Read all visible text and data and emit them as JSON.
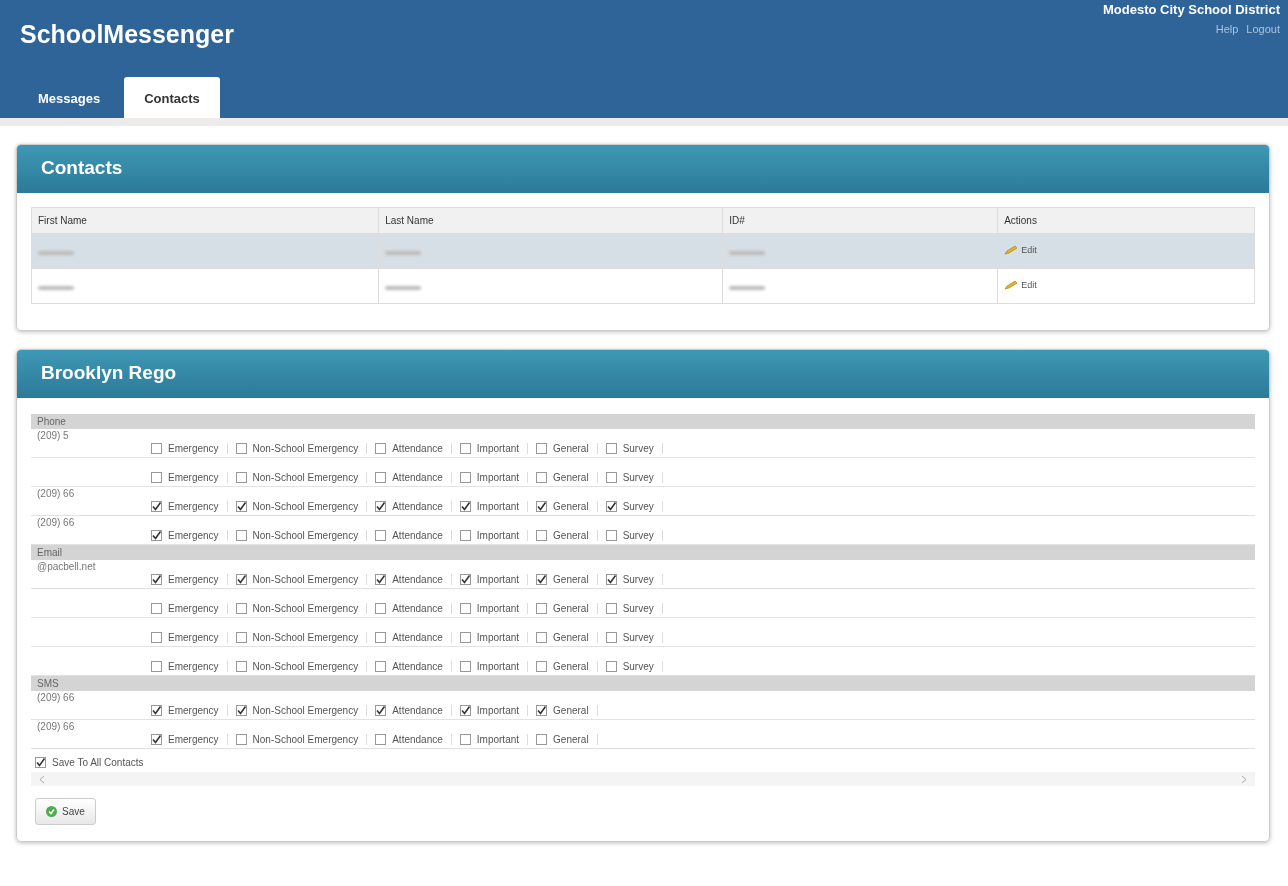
{
  "header": {
    "app_name": "SchoolMessenger",
    "district": "Modesto City School District",
    "links": [
      "Help",
      "Logout"
    ]
  },
  "tabs": [
    {
      "label": "Messages",
      "selected": false
    },
    {
      "label": "Contacts",
      "selected": true
    }
  ],
  "contacts_panel": {
    "title": "Contacts",
    "columns": [
      "First Name",
      "Last Name",
      "ID#",
      "Actions"
    ],
    "rows": [
      {
        "selected": true,
        "action": "Edit"
      },
      {
        "selected": false,
        "action": "Edit"
      }
    ]
  },
  "detail_panel": {
    "title": "Brooklyn Rego",
    "groups": [
      {
        "label": "Phone",
        "entries": [
          {
            "value": "(209) 5",
            "options": [
              {
                "label": "Emergency",
                "checked": false
              },
              {
                "label": "Non-School Emergency",
                "checked": false
              },
              {
                "label": "Attendance",
                "checked": false
              },
              {
                "label": "Important",
                "checked": false
              },
              {
                "label": "General",
                "checked": false
              },
              {
                "label": "Survey",
                "checked": false
              }
            ]
          },
          {
            "options": [
              {
                "label": "Emergency",
                "checked": false
              },
              {
                "label": "Non-School Emergency",
                "checked": false
              },
              {
                "label": "Attendance",
                "checked": false
              },
              {
                "label": "Important",
                "checked": false
              },
              {
                "label": "General",
                "checked": false
              },
              {
                "label": "Survey",
                "checked": false
              }
            ]
          },
          {
            "value": "(209) 66",
            "options": [
              {
                "label": "Emergency",
                "checked": true
              },
              {
                "label": "Non-School Emergency",
                "checked": true
              },
              {
                "label": "Attendance",
                "checked": true
              },
              {
                "label": "Important",
                "checked": true
              },
              {
                "label": "General",
                "checked": true
              },
              {
                "label": "Survey",
                "checked": true
              }
            ]
          },
          {
            "value": "(209) 66",
            "options": [
              {
                "label": "Emergency",
                "checked": true
              },
              {
                "label": "Non-School Emergency",
                "checked": false
              },
              {
                "label": "Attendance",
                "checked": false
              },
              {
                "label": "Important",
                "checked": false
              },
              {
                "label": "General",
                "checked": false
              },
              {
                "label": "Survey",
                "checked": false
              }
            ]
          }
        ]
      },
      {
        "label": "Email",
        "entries": [
          {
            "value": "@pacbell.net",
            "options": [
              {
                "label": "Emergency",
                "checked": true
              },
              {
                "label": "Non-School Emergency",
                "checked": true
              },
              {
                "label": "Attendance",
                "checked": true
              },
              {
                "label": "Important",
                "checked": true
              },
              {
                "label": "General",
                "checked": true
              },
              {
                "label": "Survey",
                "checked": true
              }
            ]
          },
          {
            "options": [
              {
                "label": "Emergency",
                "checked": false
              },
              {
                "label": "Non-School Emergency",
                "checked": false
              },
              {
                "label": "Attendance",
                "checked": false
              },
              {
                "label": "Important",
                "checked": false
              },
              {
                "label": "General",
                "checked": false
              },
              {
                "label": "Survey",
                "checked": false
              }
            ]
          },
          {
            "options": [
              {
                "label": "Emergency",
                "checked": false
              },
              {
                "label": "Non-School Emergency",
                "checked": false
              },
              {
                "label": "Attendance",
                "checked": false
              },
              {
                "label": "Important",
                "checked": false
              },
              {
                "label": "General",
                "checked": false
              },
              {
                "label": "Survey",
                "checked": false
              }
            ]
          },
          {
            "options": [
              {
                "label": "Emergency",
                "checked": false
              },
              {
                "label": "Non-School Emergency",
                "checked": false
              },
              {
                "label": "Attendance",
                "checked": false
              },
              {
                "label": "Important",
                "checked": false
              },
              {
                "label": "General",
                "checked": false
              },
              {
                "label": "Survey",
                "checked": false
              }
            ]
          }
        ]
      },
      {
        "label": "SMS",
        "entries": [
          {
            "value": "(209) 66",
            "options": [
              {
                "label": "Emergency",
                "checked": true
              },
              {
                "label": "Non-School Emergency",
                "checked": true
              },
              {
                "label": "Attendance",
                "checked": true
              },
              {
                "label": "Important",
                "checked": true
              },
              {
                "label": "General",
                "checked": true
              }
            ]
          },
          {
            "value": "(209) 66",
            "options": [
              {
                "label": "Emergency",
                "checked": true
              },
              {
                "label": "Non-School Emergency",
                "checked": false
              },
              {
                "label": "Attendance",
                "checked": false
              },
              {
                "label": "Important",
                "checked": false
              },
              {
                "label": "General",
                "checked": false
              }
            ]
          }
        ]
      }
    ],
    "save_all": {
      "label": "Save To All Contacts",
      "checked": true
    },
    "save_button": "Save"
  }
}
